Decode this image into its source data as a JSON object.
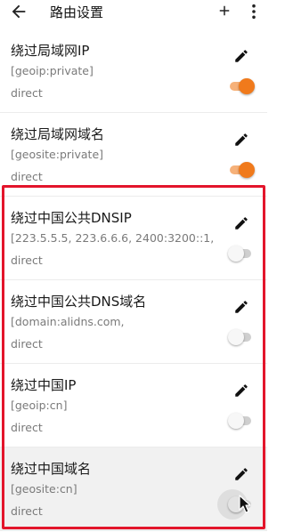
{
  "appbar": {
    "title": "路由设置",
    "back_icon": "arrow-left-icon",
    "add_icon": "plus-icon",
    "more_icon": "more-vert-icon"
  },
  "colors": {
    "accent": "#f07a1c",
    "highlight_border": "#e3152b"
  },
  "routes": [
    {
      "name": "绕过局域网IP",
      "rule": "[geoip:private]",
      "outbound": "direct",
      "enabled": true
    },
    {
      "name": "绕过局域网域名",
      "rule": "[geosite:private]",
      "outbound": "direct",
      "enabled": true
    },
    {
      "name": "绕过中国公共DNSIP",
      "rule": "[223.5.5.5, 223.6.6.6, 2400:3200::1,",
      "outbound": "direct",
      "enabled": false
    },
    {
      "name": "绕过中国公共DNS域名",
      "rule": "[domain:alidns.com,",
      "outbound": "direct",
      "enabled": false
    },
    {
      "name": "绕过中国IP",
      "rule": "[geoip:cn]",
      "outbound": "direct",
      "enabled": false
    },
    {
      "name": "绕过中国域名",
      "rule": "[geosite:cn]",
      "outbound": "direct",
      "enabled": false
    }
  ]
}
